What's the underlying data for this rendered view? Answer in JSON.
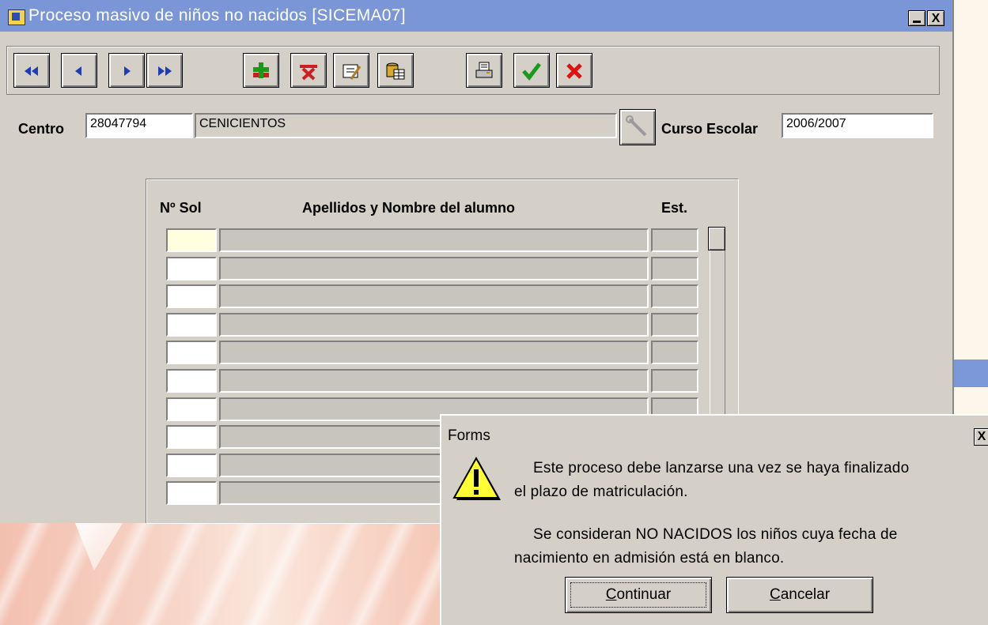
{
  "window": {
    "title": "Proceso masivo de niños no nacidos [SICEMA07]",
    "min_label": "_",
    "close_label": "X"
  },
  "toolbar": {
    "buttons": [
      {
        "name": "first-record-icon"
      },
      {
        "name": "previous-record-icon"
      },
      {
        "name": "next-record-icon"
      },
      {
        "name": "last-record-icon"
      },
      {
        "name": "insert-record-icon"
      },
      {
        "name": "delete-record-icon"
      },
      {
        "name": "edit-record-icon"
      },
      {
        "name": "query-icon"
      },
      {
        "name": "print-icon"
      },
      {
        "name": "accept-icon"
      },
      {
        "name": "cancel-icon"
      }
    ]
  },
  "header": {
    "centro_label": "Centro",
    "centro_code": "28047794",
    "centro_name": "CENICIENTOS",
    "curso_label": "Curso Escolar",
    "curso_value": "2006/2007"
  },
  "table": {
    "col_nsol": "Nº Sol",
    "col_nombre": "Apellidos y Nombre del alumno",
    "col_est": "Est.",
    "row_count": 10
  },
  "dialog": {
    "title": "Forms",
    "close_label": "X",
    "line1": "Este proceso debe lanzarse una vez se haya finalizado",
    "line2": "el plazo de matriculación.",
    "line3": "Se consideran NO NACIDOS los niños cuya fecha de",
    "line4": "nacimiento en admisión está en blanco.",
    "continue_accel": "C",
    "continue_rest": "ontinuar",
    "cancel_accel": "C",
    "cancel_rest": "ancelar"
  },
  "colors": {
    "titlebar": "#7b96d6",
    "face": "#d4d0c8",
    "active_cell": "#ffffe0"
  }
}
